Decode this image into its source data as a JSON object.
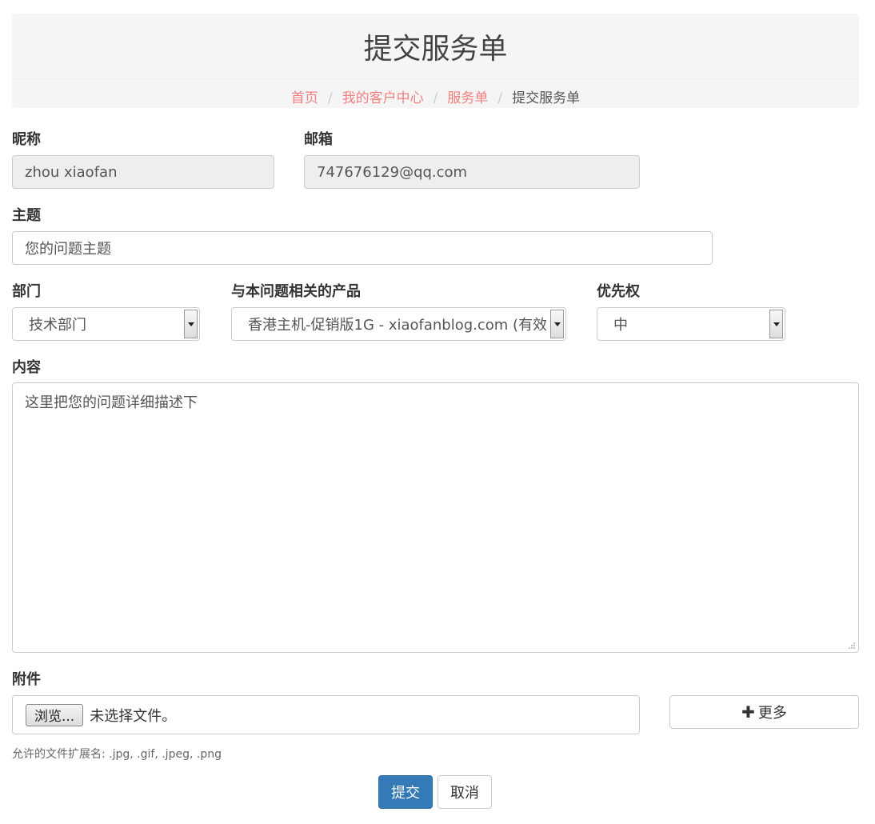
{
  "header": {
    "title": "提交服务单",
    "breadcrumb": {
      "home": "首页",
      "customer_center": "我的客户中心",
      "tickets": "服务单",
      "current": "提交服务单",
      "separator": "/"
    }
  },
  "form": {
    "nickname": {
      "label": "昵称",
      "value": "zhou xiaofan"
    },
    "email": {
      "label": "邮箱",
      "value": "747676129@qq.com"
    },
    "subject": {
      "label": "主题",
      "placeholder": "您的问题主题"
    },
    "department": {
      "label": "部门",
      "selected": "技术部门"
    },
    "product": {
      "label": "与本问题相关的产品",
      "selected": "香港主机-促销版1G - xiaofanblog.com (有效"
    },
    "priority": {
      "label": "优先权",
      "selected": "中"
    },
    "content": {
      "label": "内容",
      "placeholder": "这里把您的问题详细描述下"
    },
    "attachment": {
      "label": "附件",
      "browse_label": "浏览...",
      "status": "未选择文件。",
      "more_label": "更多",
      "hint": "允许的文件扩展名: .jpg, .gif, .jpeg, .png"
    }
  },
  "actions": {
    "submit_label": "提交",
    "cancel_label": "取消"
  },
  "colors": {
    "link": "#f08080",
    "primary": "#337ab7"
  }
}
